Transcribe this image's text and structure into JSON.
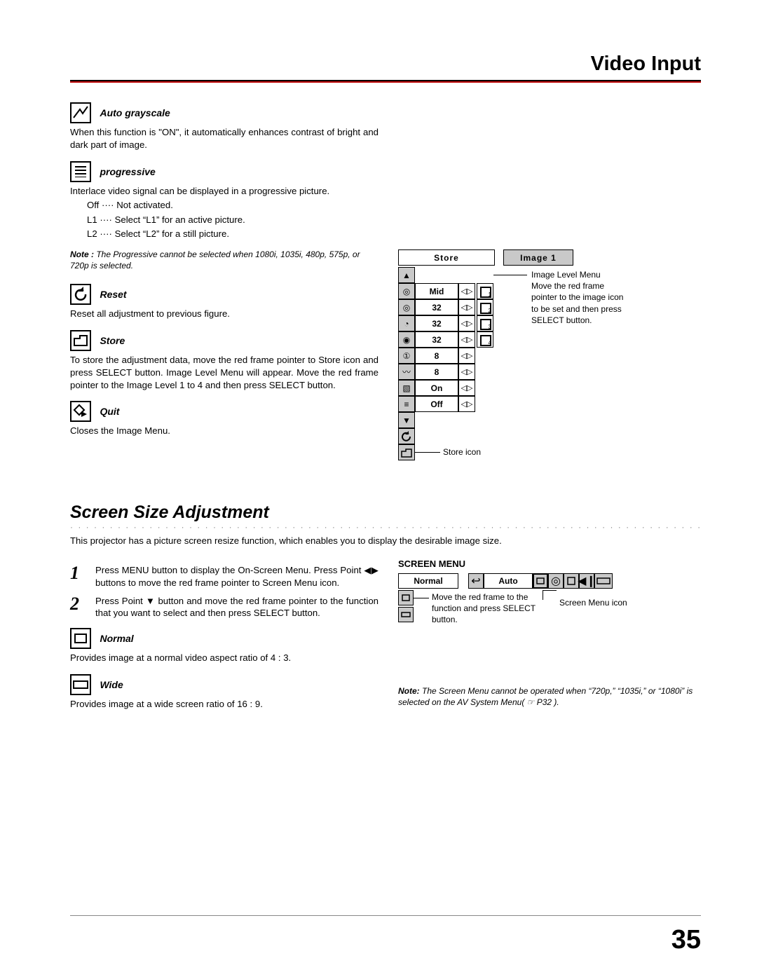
{
  "header": "Video Input",
  "page_number": "35",
  "sections": {
    "auto_grayscale": {
      "title": "Auto grayscale",
      "body": "When this function is \"ON\", it automatically enhances contrast of bright and dark part of image."
    },
    "progressive": {
      "title": "progressive",
      "intro": "Interlace video signal can be displayed in a progressive picture.",
      "items": {
        "off": "Off ···· Not activated.",
        "l1": "L1  ···· Select “L1” for an active picture.",
        "l2": "L2  ···· Select “L2” for a still picture."
      },
      "note_label": "Note :",
      "note": "The Progressive cannot be selected when 1080i, 1035i, 480p, 575p, or 720p is selected."
    },
    "reset": {
      "title": "Reset",
      "body": "Reset all adjustment to previous figure."
    },
    "store": {
      "title": "Store",
      "body": "To store the adjustment data, move the red frame pointer to Store icon and press SELECT button.  Image Level Menu will appear.  Move the red frame pointer to the Image Level 1 to 4 and then press SELECT button."
    },
    "quit": {
      "title": "Quit",
      "body": "Closes the Image Menu."
    }
  },
  "menu": {
    "header_left": "Store",
    "header_right": "Image 1",
    "rows": [
      {
        "value": "Mid",
        "sq": "1"
      },
      {
        "value": "32",
        "sq": "2"
      },
      {
        "value": "32",
        "sq": "3"
      },
      {
        "value": "32",
        "sq": "4"
      },
      {
        "value": "8",
        "sq": ""
      },
      {
        "value": "8",
        "sq": ""
      },
      {
        "value": "On",
        "sq": ""
      },
      {
        "value": "Off",
        "sq": ""
      }
    ],
    "callout": "Image Level Menu\nMove the red frame pointer to the image icon to be set and then press SELECT button.",
    "store_icon_label": "Store icon"
  },
  "screen_adjust": {
    "heading": "Screen Size Adjustment",
    "intro": "This projector has a picture screen resize function, which enables you to display the desirable image size.",
    "step1": "Press MENU button to display the On-Screen Menu.  Press Point ◀▶ buttons to move the red frame pointer to Screen Menu icon.",
    "step2": "Press Point ▼ button and move the red frame pointer to the function that you want to select and then press SELECT button.",
    "normal_title": "Normal",
    "normal_body": "Provides image at a normal video aspect ratio of 4 : 3.",
    "wide_title": "Wide",
    "wide_body": "Provides image at a wide screen ratio of 16 : 9."
  },
  "screen_menu": {
    "title": "SCREEN MENU",
    "label_normal": "Normal",
    "label_auto": "Auto",
    "callout_left": "Move the red frame to the function and press SELECT button.",
    "callout_right": "Screen Menu icon",
    "note_label": "Note:",
    "note": "The Screen Menu cannot be operated when “720p,” “1035i,” or “1080i” is selected on the AV System Menu( ☞ P32 )."
  }
}
